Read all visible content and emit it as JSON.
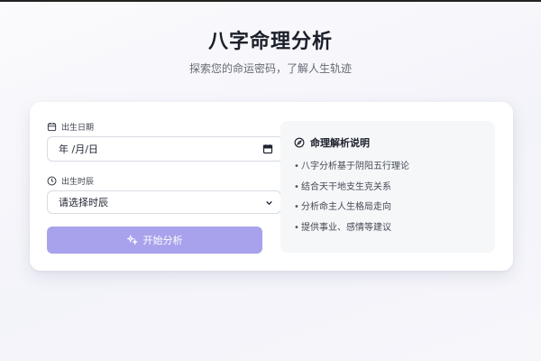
{
  "header": {
    "title": "八字命理分析",
    "subtitle": "探索您的命运密码，了解人生轨迹"
  },
  "form": {
    "birth_date_label": "出生日期",
    "birth_date_value": "年 /月/日",
    "birth_time_label": "出生时辰",
    "birth_time_selected": "请选择时辰",
    "submit_label": "开始分析"
  },
  "info": {
    "title": "命理解析说明",
    "items": [
      "八字分析基于阴阳五行理论",
      "结合天干地支生克关系",
      "分析命主人生格局走向",
      "提供事业、感情等建议"
    ]
  },
  "colors": {
    "accent": "#a8a2ec",
    "card_bg": "#ffffff",
    "info_bg": "#f6f7f9"
  },
  "icons": {
    "birth_date": "calendar-icon",
    "birth_time": "clock-icon",
    "submit": "sparkles-icon",
    "info": "compass-icon",
    "date_picker": "calendar-picker-icon",
    "select": "chevron-down-icon"
  }
}
